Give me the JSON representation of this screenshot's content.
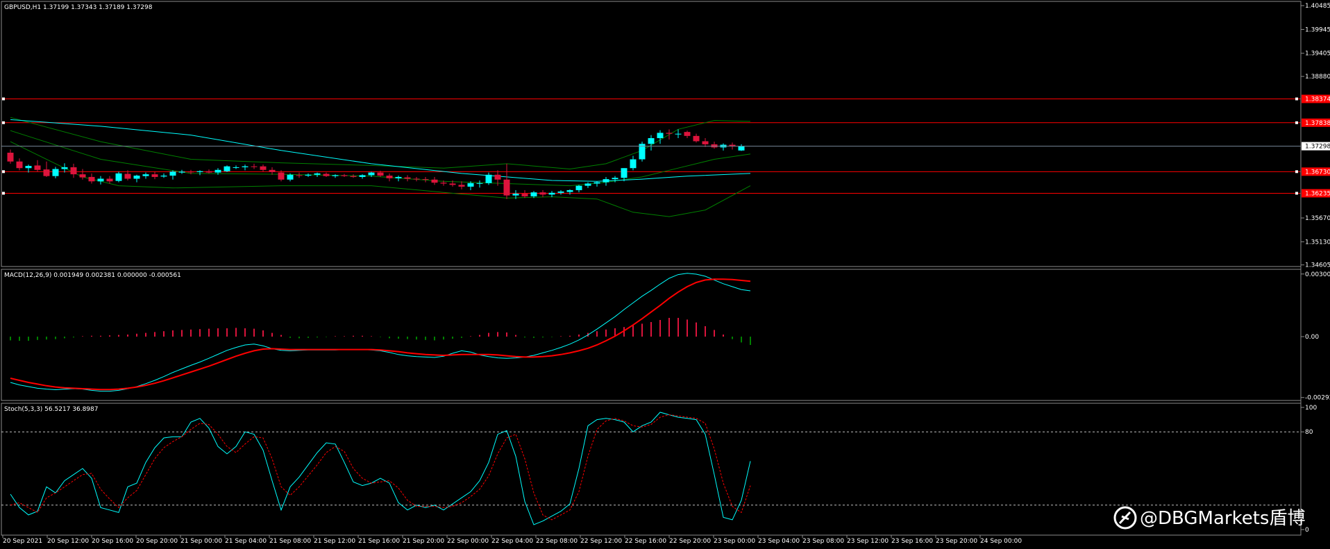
{
  "window": {
    "symbol_line": "GBPUSD,H1  1.37199 1.37343 1.37189 1.37298"
  },
  "watermark": "@DBGMarkets盾博",
  "colors": {
    "background": "#000000",
    "bull": "#00ffff",
    "bear": "#dc143c",
    "hline": "#ff0000",
    "bands": "#008000",
    "ma": "#00ffff",
    "macd_signal": "#ff0000",
    "stoch_main": "#00ffff",
    "stoch_signal": "#ff0000"
  },
  "chart_data": [
    {
      "type": "candlestick",
      "title": "GBPUSD,H1",
      "ohlc_readout": "1.37199 1.37343 1.37189 1.37298",
      "y_ticks": [
        "1.40485",
        "1.39945",
        "1.39405",
        "1.38880",
        "1.35670",
        "1.35130",
        "1.34605"
      ],
      "ylim": [
        1.346,
        1.4055
      ],
      "current_price_label": "1.37298",
      "current_price": 1.37298,
      "horizontal_lines": [
        {
          "value": 1.3837,
          "label": "1.38374"
        },
        {
          "value": 1.3783,
          "label": "1.37838"
        },
        {
          "value": 1.3672,
          "label": "1.36730"
        },
        {
          "value": 1.3623,
          "label": "1.36235"
        }
      ],
      "candles": [
        [
          1.3715,
          1.3722,
          1.369,
          1.3695
        ],
        [
          1.3695,
          1.3702,
          1.3675,
          1.368
        ],
        [
          1.368,
          1.3688,
          1.367,
          1.3685
        ],
        [
          1.3686,
          1.3698,
          1.3672,
          1.3676
        ],
        [
          1.3677,
          1.3695,
          1.366,
          1.3662
        ],
        [
          1.3662,
          1.3683,
          1.3657,
          1.3678
        ],
        [
          1.3678,
          1.3691,
          1.367,
          1.3682
        ],
        [
          1.3682,
          1.369,
          1.3658,
          1.3666
        ],
        [
          1.3666,
          1.3678,
          1.3654,
          1.3659
        ],
        [
          1.366,
          1.3668,
          1.3645,
          1.365
        ],
        [
          1.365,
          1.3662,
          1.3643,
          1.3656
        ],
        [
          1.3656,
          1.3662,
          1.3645,
          1.365
        ],
        [
          1.3651,
          1.3672,
          1.3648,
          1.3668
        ],
        [
          1.3667,
          1.3675,
          1.3652,
          1.3656
        ],
        [
          1.3656,
          1.3665,
          1.3648,
          1.3663
        ],
        [
          1.3662,
          1.367,
          1.3656,
          1.3666
        ],
        [
          1.3666,
          1.3672,
          1.3655,
          1.366
        ],
        [
          1.3661,
          1.3668,
          1.3658,
          1.3663
        ],
        [
          1.3663,
          1.3675,
          1.3654,
          1.3672
        ],
        [
          1.367,
          1.3676,
          1.3667,
          1.3672
        ],
        [
          1.3672,
          1.3676,
          1.3666,
          1.3671
        ],
        [
          1.3671,
          1.3675,
          1.3664,
          1.3673
        ],
        [
          1.3673,
          1.3677,
          1.3668,
          1.367
        ],
        [
          1.367,
          1.368,
          1.3665,
          1.3676
        ],
        [
          1.3673,
          1.3686,
          1.3671,
          1.3684
        ],
        [
          1.3681,
          1.3686,
          1.3678,
          1.3682
        ],
        [
          1.3682,
          1.3688,
          1.3675,
          1.3684
        ],
        [
          1.3684,
          1.369,
          1.3678,
          1.3683
        ],
        [
          1.3684,
          1.3688,
          1.3672,
          1.3676
        ],
        [
          1.3676,
          1.3682,
          1.3665,
          1.3671
        ],
        [
          1.367,
          1.3675,
          1.365,
          1.3654
        ],
        [
          1.3654,
          1.3668,
          1.365,
          1.3665
        ],
        [
          1.3664,
          1.367,
          1.3658,
          1.3663
        ],
        [
          1.3663,
          1.3668,
          1.366,
          1.3665
        ],
        [
          1.3665,
          1.367,
          1.366,
          1.3668
        ],
        [
          1.3667,
          1.367,
          1.366,
          1.3662
        ],
        [
          1.3662,
          1.3666,
          1.3658,
          1.3664
        ],
        [
          1.3664,
          1.3667,
          1.366,
          1.3662
        ],
        [
          1.3662,
          1.3666,
          1.3658,
          1.366
        ],
        [
          1.366,
          1.3666,
          1.3656,
          1.3664
        ],
        [
          1.3664,
          1.3672,
          1.366,
          1.367
        ],
        [
          1.367,
          1.3674,
          1.366,
          1.3663
        ],
        [
          1.3663,
          1.3668,
          1.365,
          1.3657
        ],
        [
          1.3657,
          1.3663,
          1.365,
          1.366
        ],
        [
          1.3659,
          1.3664,
          1.365,
          1.3656
        ],
        [
          1.3656,
          1.366,
          1.365,
          1.3655
        ],
        [
          1.3655,
          1.366,
          1.3648,
          1.3654
        ],
        [
          1.3654,
          1.366,
          1.3642,
          1.3647
        ],
        [
          1.3647,
          1.3652,
          1.364,
          1.3645
        ],
        [
          1.3645,
          1.3652,
          1.3638,
          1.3642
        ],
        [
          1.3642,
          1.365,
          1.3632,
          1.3638
        ],
        [
          1.3638,
          1.365,
          1.363,
          1.3646
        ],
        [
          1.3645,
          1.3652,
          1.3636,
          1.3646
        ],
        [
          1.3646,
          1.367,
          1.3642,
          1.3665
        ],
        [
          1.3665,
          1.3675,
          1.364,
          1.3654
        ],
        [
          1.3654,
          1.369,
          1.361,
          1.3618
        ],
        [
          1.3618,
          1.363,
          1.361,
          1.3622
        ],
        [
          1.3622,
          1.363,
          1.3612,
          1.3616
        ],
        [
          1.3616,
          1.3628,
          1.3612,
          1.3625
        ],
        [
          1.3625,
          1.363,
          1.3614,
          1.362
        ],
        [
          1.362,
          1.3628,
          1.3614,
          1.3624
        ],
        [
          1.3624,
          1.363,
          1.362,
          1.3627
        ],
        [
          1.3626,
          1.3632,
          1.362,
          1.363
        ],
        [
          1.363,
          1.3642,
          1.3625,
          1.364
        ],
        [
          1.364,
          1.3648,
          1.3635,
          1.3645
        ],
        [
          1.3645,
          1.365,
          1.3638,
          1.3648
        ],
        [
          1.3648,
          1.366,
          1.364,
          1.3655
        ],
        [
          1.3655,
          1.3662,
          1.3648,
          1.3658
        ],
        [
          1.3658,
          1.368,
          1.365,
          1.368
        ],
        [
          1.368,
          1.3708,
          1.3675,
          1.37
        ],
        [
          1.37,
          1.374,
          1.3695,
          1.3735
        ],
        [
          1.3735,
          1.3755,
          1.372,
          1.3748
        ],
        [
          1.3748,
          1.3766,
          1.3735,
          1.376
        ],
        [
          1.376,
          1.3768,
          1.3745,
          1.3758
        ],
        [
          1.3758,
          1.3768,
          1.3748,
          1.3758
        ],
        [
          1.3762,
          1.3765,
          1.3748,
          1.3753
        ],
        [
          1.3753,
          1.3758,
          1.3738,
          1.3741
        ],
        [
          1.3741,
          1.3748,
          1.3728,
          1.3734
        ],
        [
          1.3734,
          1.374,
          1.3724,
          1.3727
        ],
        [
          1.3727,
          1.3736,
          1.372,
          1.3733
        ],
        [
          1.3733,
          1.3738,
          1.3722,
          1.373
        ],
        [
          1.372,
          1.3734,
          1.3719,
          1.373
        ]
      ],
      "x_tick_labels": [
        "20 Sep 2021",
        "20 Sep 12:00",
        "20 Sep 16:00",
        "20 Sep 20:00",
        "21 Sep 00:00",
        "21 Sep 04:00",
        "21 Sep 08:00",
        "21 Sep 12:00",
        "21 Sep 16:00",
        "21 Sep 20:00",
        "22 Sep 00:00",
        "22 Sep 04:00",
        "22 Sep 08:00",
        "22 Sep 12:00",
        "22 Sep 16:00",
        "22 Sep 20:00",
        "23 Sep 00:00",
        "23 Sep 04:00",
        "23 Sep 08:00",
        "23 Sep 12:00",
        "23 Sep 16:00",
        "23 Sep 20:00",
        "24 Sep 00:00"
      ],
      "ma_line": [
        [
          0,
          1.379
        ],
        [
          10,
          1.3775
        ],
        [
          20,
          1.3755
        ],
        [
          30,
          1.372
        ],
        [
          40,
          1.369
        ],
        [
          50,
          1.3668
        ],
        [
          55,
          1.366
        ],
        [
          60,
          1.3652
        ],
        [
          65,
          1.365
        ],
        [
          70,
          1.3655
        ],
        [
          75,
          1.3662
        ],
        [
          82,
          1.3668
        ]
      ],
      "band_upper": [
        [
          0,
          1.3795
        ],
        [
          10,
          1.374
        ],
        [
          20,
          1.37
        ],
        [
          30,
          1.3692
        ],
        [
          40,
          1.3686
        ],
        [
          48,
          1.368
        ],
        [
          55,
          1.369
        ],
        [
          62,
          1.3678
        ],
        [
          66,
          1.369
        ],
        [
          70,
          1.372
        ],
        [
          74,
          1.3768
        ],
        [
          78,
          1.3788
        ],
        [
          82,
          1.3786
        ]
      ],
      "band_lower": [
        [
          0,
          1.374
        ],
        [
          8,
          1.366
        ],
        [
          12,
          1.364
        ],
        [
          18,
          1.3635
        ],
        [
          30,
          1.364
        ],
        [
          40,
          1.364
        ],
        [
          48,
          1.3625
        ],
        [
          55,
          1.3612
        ],
        [
          60,
          1.3615
        ],
        [
          65,
          1.361
        ],
        [
          69,
          1.358
        ],
        [
          73,
          1.357
        ],
        [
          77,
          1.3585
        ],
        [
          82,
          1.364
        ]
      ],
      "band_middle": [
        [
          0,
          1.3765
        ],
        [
          10,
          1.37
        ],
        [
          20,
          1.3668
        ],
        [
          30,
          1.3666
        ],
        [
          40,
          1.3662
        ],
        [
          48,
          1.365
        ],
        [
          55,
          1.3645
        ],
        [
          62,
          1.364
        ],
        [
          66,
          1.3648
        ],
        [
          70,
          1.366
        ],
        [
          74,
          1.368
        ],
        [
          78,
          1.37
        ],
        [
          82,
          1.3712
        ]
      ]
    },
    {
      "type": "macd",
      "title": "MACD(12,26,9) 0.001949 0.002381 0.000000 -0.000561",
      "y_ticks": [
        "0.003007",
        "0.00",
        "-0.002924"
      ],
      "ylim": [
        -0.003,
        0.0031
      ],
      "histogram": [
        -0.00018,
        -0.0002,
        -0.0002,
        -0.00016,
        -0.00014,
        -0.00012,
        -8e-05,
        -4e-05,
        2e-05,
        4e-05,
        4e-05,
        6e-05,
        8e-05,
        0.0001,
        0.00014,
        0.00018,
        0.00022,
        0.00026,
        0.0003,
        0.00032,
        0.00034,
        0.00036,
        0.00038,
        0.0004,
        0.0004,
        0.00042,
        0.0004,
        0.00038,
        0.0003,
        0.00018,
        8e-05,
        -6e-05,
        -8e-05,
        -6e-05,
        -4e-05,
        -2e-05,
        2e-05,
        2e-05,
        4e-05,
        4e-05,
        2e-05,
        -2e-05,
        -8e-05,
        -0.0001,
        -0.00012,
        -0.00014,
        -0.00016,
        -0.00018,
        -0.00014,
        -0.0001,
        -6e-05,
        2e-05,
        8e-05,
        0.00018,
        0.00022,
        0.0002,
        8e-05,
        -4e-05,
        -6e-05,
        -4e-05,
        -2e-05,
        2e-05,
        4e-05,
        0.0001,
        0.00018,
        0.00026,
        0.00034,
        0.0004,
        0.00046,
        0.00054,
        0.00062,
        0.0007,
        0.0008,
        0.0009,
        0.0009,
        0.00082,
        0.00068,
        0.0005,
        0.00032,
        0.0001,
        -0.00012,
        -0.00028,
        -0.0004
      ],
      "macd_line": [
        -0.0022,
        -0.00232,
        -0.0024,
        -0.00248,
        -0.00252,
        -0.00255,
        -0.00252,
        -0.0025,
        -0.00252,
        -0.00258,
        -0.00262,
        -0.00262,
        -0.00258,
        -0.0025,
        -0.0024,
        -0.00226,
        -0.0021,
        -0.00192,
        -0.00172,
        -0.00155,
        -0.00138,
        -0.00122,
        -0.00104,
        -0.00085,
        -0.00066,
        -0.00052,
        -0.0004,
        -0.00036,
        -0.00044,
        -0.00058,
        -0.00066,
        -0.00068,
        -0.00066,
        -0.00064,
        -0.00064,
        -0.00064,
        -0.00064,
        -0.00062,
        -0.00062,
        -0.00062,
        -0.00064,
        -0.00068,
        -0.00076,
        -0.00086,
        -0.00092,
        -0.00096,
        -0.00098,
        -0.001,
        -0.00094,
        -0.0008,
        -0.00068,
        -0.00074,
        -0.00088,
        -0.00096,
        -0.00102,
        -0.00104,
        -0.00102,
        -0.00098,
        -0.0009,
        -0.00078,
        -0.00066,
        -0.00052,
        -0.00036,
        -0.00016,
        8e-05,
        0.00036,
        0.00066,
        0.00096,
        0.0013,
        0.00162,
        0.00194,
        0.00222,
        0.00252,
        0.0028,
        0.00298,
        0.00304,
        0.003,
        0.0029,
        0.00272,
        0.00254,
        0.0024,
        0.00226,
        0.0022
      ],
      "signal_line": [
        -0.002,
        -0.0021,
        -0.0022,
        -0.00228,
        -0.00236,
        -0.00242,
        -0.00246,
        -0.00248,
        -0.0025,
        -0.00252,
        -0.00254,
        -0.00254,
        -0.00252,
        -0.00248,
        -0.00242,
        -0.00234,
        -0.00224,
        -0.00212,
        -0.00198,
        -0.00184,
        -0.0017,
        -0.00156,
        -0.00142,
        -0.00126,
        -0.0011,
        -0.00094,
        -0.0008,
        -0.00068,
        -0.0006,
        -0.00058,
        -0.0006,
        -0.00062,
        -0.00062,
        -0.00062,
        -0.00062,
        -0.00062,
        -0.00062,
        -0.00062,
        -0.00062,
        -0.00062,
        -0.00062,
        -0.00064,
        -0.00068,
        -0.00072,
        -0.00078,
        -0.00082,
        -0.00086,
        -0.00088,
        -0.0009,
        -0.00088,
        -0.00086,
        -0.00086,
        -0.00086,
        -0.00086,
        -0.00088,
        -0.00092,
        -0.00096,
        -0.00098,
        -0.00098,
        -0.00096,
        -0.00092,
        -0.00086,
        -0.00078,
        -0.00068,
        -0.00056,
        -0.0004,
        -0.0002,
        2e-05,
        0.00028,
        0.00056,
        0.00086,
        0.00118,
        0.0015,
        0.00184,
        0.00214,
        0.0024,
        0.0026,
        0.00272,
        0.00276,
        0.00276,
        0.00274,
        0.0027,
        0.00266
      ]
    },
    {
      "type": "stochastic",
      "title": "Stoch(5,3,3) 56.5217 36.8987",
      "y_ticks": [
        "100",
        "80",
        "0"
      ],
      "levels": [
        80,
        20
      ],
      "ylim": [
        0,
        100
      ],
      "main_line": [
        29,
        18,
        12,
        15,
        35,
        30,
        40,
        45,
        50,
        42,
        18,
        16,
        14,
        35,
        38,
        55,
        67,
        75,
        76,
        76,
        88,
        91,
        83,
        68,
        62,
        68,
        80,
        78,
        65,
        40,
        16,
        35,
        43,
        53,
        63,
        71,
        70,
        55,
        39,
        36,
        38,
        42,
        38,
        22,
        16,
        20,
        18,
        20,
        16,
        21,
        26,
        31,
        40,
        55,
        78,
        81,
        60,
        23,
        4,
        7,
        11,
        15,
        21,
        50,
        85,
        90,
        91,
        90,
        88,
        80,
        85,
        88,
        96,
        94,
        92,
        91,
        90,
        78,
        45,
        10,
        8,
        24,
        56
      ],
      "signal_line": [
        20,
        22,
        18,
        14,
        26,
        30,
        35,
        40,
        45,
        46,
        33,
        25,
        18,
        26,
        32,
        45,
        58,
        67,
        72,
        76,
        82,
        87,
        86,
        78,
        68,
        63,
        70,
        76,
        75,
        58,
        35,
        28,
        35,
        44,
        53,
        63,
        68,
        64,
        50,
        42,
        38,
        39,
        40,
        34,
        24,
        19,
        19,
        19,
        18,
        19,
        22,
        27,
        33,
        44,
        62,
        75,
        78,
        58,
        30,
        12,
        8,
        12,
        16,
        31,
        60,
        82,
        89,
        91,
        89,
        85,
        84,
        86,
        92,
        94,
        93,
        92,
        91,
        87,
        66,
        38,
        19,
        14,
        36
      ]
    }
  ]
}
